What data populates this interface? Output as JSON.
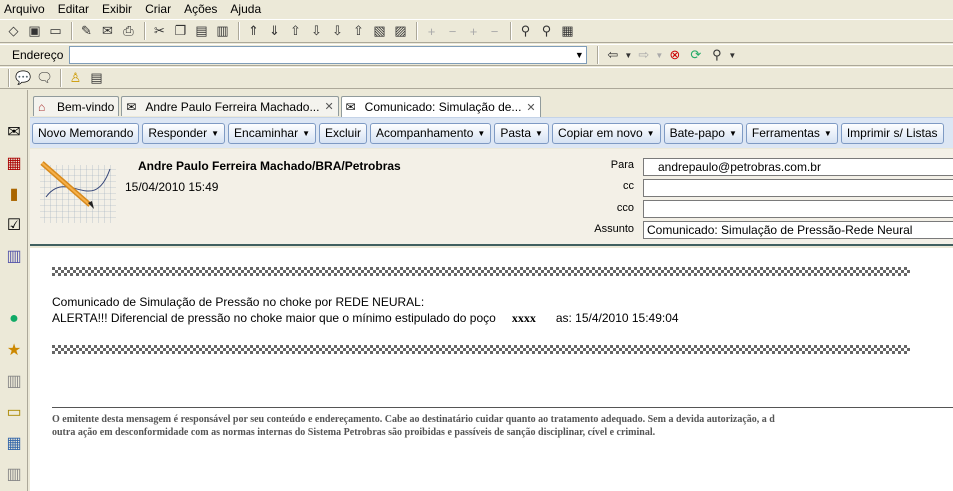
{
  "menu": [
    "Arquivo",
    "Editar",
    "Exibir",
    "Criar",
    "Ações",
    "Ajuda"
  ],
  "address": {
    "label": "Endereço",
    "value": ""
  },
  "tabs": [
    {
      "label": "Bem-vindo",
      "icon": "home-icon",
      "closable": false
    },
    {
      "label": "Andre Paulo Ferreira Machado...",
      "icon": "mail-envelope-icon",
      "closable": true
    },
    {
      "label": "Comunicado: Simulação de...",
      "icon": "memo-icon",
      "closable": true,
      "active": true
    }
  ],
  "actions": [
    {
      "label": "Novo Memorando",
      "dropdown": false
    },
    {
      "label": "Responder",
      "dropdown": true
    },
    {
      "label": "Encaminhar",
      "dropdown": true
    },
    {
      "label": "Excluir",
      "dropdown": false
    },
    {
      "label": "Acompanhamento",
      "dropdown": true
    },
    {
      "label": "Pasta",
      "dropdown": true
    },
    {
      "label": "Copiar em novo",
      "dropdown": true
    },
    {
      "label": "Bate-papo",
      "dropdown": true
    },
    {
      "label": "Ferramentas",
      "dropdown": true
    },
    {
      "label": "Imprimir s/ Listas",
      "dropdown": false
    }
  ],
  "memo": {
    "sender": "Andre Paulo Ferreira Machado/BRA/Petrobras",
    "date": "15/04/2010 15:49",
    "labels": {
      "to": "Para",
      "cc": "cc",
      "bcc": "cco",
      "subject": "Assunto"
    },
    "to": "andrepaulo@petrobras.com.br",
    "cc": "",
    "bcc": "",
    "subject": "Comunicado: Simulação de Pressão-Rede Neural"
  },
  "body": {
    "line1": "Comunicado de Simulação de Pressão no choke  por REDE NEURAL:",
    "line2_prefix": "ALERTA!!! Diferencial de pressão no choke maior que o mínimo estipulado do poço",
    "well": "xxxx",
    "line2_suffix": "as: 15/4/2010 15:49:04",
    "disclaimer1": "O emitente desta mensagem é responsável por seu conteúdo e endereçamento. Cabe ao destinatário cuidar quanto ao tratamento adequado. Sem a devida autorização, a d",
    "disclaimer2": "outra ação em desconformidade com as normas internas do Sistema Petrobras são proibidas e passíveis de sanção disciplinar, cível e criminal."
  },
  "colors": {
    "actionbar_bg": "#dce6f4",
    "button_border": "#7e9ac4",
    "header_bg": "#f3f0e7",
    "chrome": "#ece9d8"
  }
}
